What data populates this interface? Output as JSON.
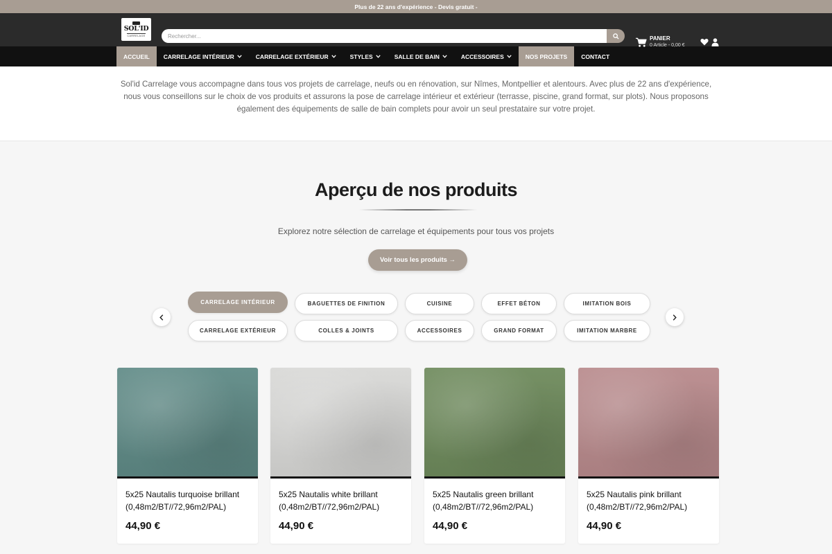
{
  "topbar": {
    "text": "Plus de 22 ans d'expérience - Devis gratuit -"
  },
  "header": {
    "logo": {
      "main": "SOL'ID",
      "sub": "CARRELAGE"
    },
    "search": {
      "placeholder": "Rechercher..."
    },
    "cart": {
      "label": "PANIER",
      "summary": "0 Article - 0,00 €"
    },
    "icons": [
      "search-icon",
      "cart-icon",
      "heart-icon",
      "user-icon"
    ]
  },
  "nav": {
    "items": [
      {
        "label": "ACCUEIL",
        "active": true,
        "dropdown": false
      },
      {
        "label": "CARRELAGE INTÉRIEUR",
        "active": false,
        "dropdown": true
      },
      {
        "label": "CARRELAGE EXTÉRIEUR",
        "active": false,
        "dropdown": true
      },
      {
        "label": "STYLES",
        "active": false,
        "dropdown": true
      },
      {
        "label": "SALLE DE BAIN",
        "active": false,
        "dropdown": true
      },
      {
        "label": "ACCESSOIRES",
        "active": false,
        "dropdown": true
      },
      {
        "label": "NOS PROJETS",
        "active": true,
        "dropdown": false
      },
      {
        "label": "CONTACT",
        "active": false,
        "dropdown": false
      }
    ]
  },
  "intro": {
    "text": "Sol'id Carrelage vous accompagne dans tous vos projets de carrelage, neufs ou en rénovation, sur Nîmes, Montpellier et alentours. Avec plus de 22 ans d'expérience, nous vous conseillons sur le choix de vos produits et assurons la pose de carrelage intérieur et extérieur (terrasse, piscine, grand format, sur plots). Nous proposons également des équipements de salle de bain complets pour avoir un seul prestataire sur votre projet."
  },
  "products_section": {
    "title": "Aperçu de nos produits",
    "subtitle": "Explorez notre sélection de carrelage et équipements pour tous vos projets",
    "cta_label": "Voir tous les produits →",
    "categories": [
      {
        "label": "CARRELAGE INTÉRIEUR",
        "active": true
      },
      {
        "label": "BAGUETTES DE FINITION",
        "active": false
      },
      {
        "label": "CUISINE",
        "active": false
      },
      {
        "label": "EFFET BÉTON",
        "active": false
      },
      {
        "label": "IMITATION BOIS",
        "active": false
      },
      {
        "label": "CARRELAGE EXTÉRIEUR",
        "active": false
      },
      {
        "label": "COLLES & JOINTS",
        "active": false
      },
      {
        "label": "ACCESSOIRES",
        "active": false
      },
      {
        "label": "GRAND FORMAT",
        "active": false
      },
      {
        "label": "IMITATION MARBRE",
        "active": false
      }
    ],
    "products": [
      {
        "name": "5x25 Nautalis turquoise brillant (0,48m2/BT//72,96m2/PAL)",
        "price": "44,90 €",
        "color": "#5f8a86"
      },
      {
        "name": "5x25 Nautalis white brillant (0,48m2/BT//72,96m2/PAL)",
        "price": "44,90 €",
        "color": "#d8d8d6"
      },
      {
        "name": "5x25 Nautalis green brillant (0,48m2/BT//72,96m2/PAL)",
        "price": "44,90 €",
        "color": "#6e8a5c"
      },
      {
        "name": "5x25 Nautalis pink brillant (0,48m2/BT//72,96m2/PAL)",
        "price": "44,90 €",
        "color": "#b88a8c"
      }
    ]
  },
  "colors": {
    "accent": "#a89d93",
    "header_bg": "#2b2b2b",
    "nav_bg": "#111111"
  }
}
